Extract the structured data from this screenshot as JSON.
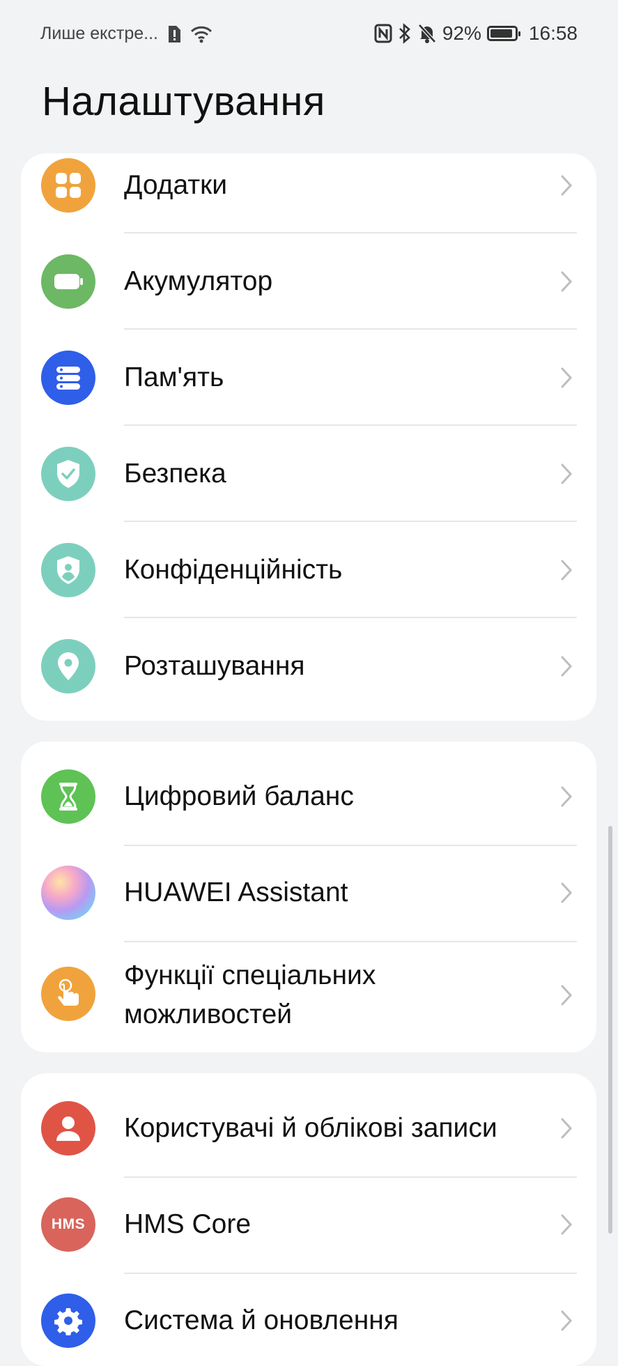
{
  "status_bar": {
    "carrier_text": "Лише екстре...",
    "battery_percent": "92%",
    "time": "16:58",
    "icons": [
      "sim-alert-icon",
      "wifi-icon",
      "nfc-icon",
      "bluetooth-icon",
      "muted-bell-icon",
      "battery-icon"
    ]
  },
  "page": {
    "title": "Налаштування"
  },
  "groups": [
    {
      "items": [
        {
          "label": "Додатки",
          "icon": "apps-icon",
          "color": "#f0a33c"
        },
        {
          "label": "Акумулятор",
          "icon": "battery-icon",
          "color": "#6cb865"
        },
        {
          "label": "Пам'ять",
          "icon": "storage-icon",
          "color": "#2f5ee8"
        },
        {
          "label": "Безпека",
          "icon": "shield-check-icon",
          "color": "#7dcfbd"
        },
        {
          "label": "Конфіденційність",
          "icon": "privacy-shield-icon",
          "color": "#7dcfbd"
        },
        {
          "label": "Розташування",
          "icon": "location-pin-icon",
          "color": "#7dcfbd"
        }
      ]
    },
    {
      "items": [
        {
          "label": "Цифровий баланс",
          "icon": "hourglass-icon",
          "color": "#5ec255"
        },
        {
          "label": "HUAWEI Assistant",
          "icon": "huawei-assistant-icon",
          "color": "#c9a6f2"
        },
        {
          "label_line1": "Функції спеціальних",
          "label_line2": "можливостей",
          "icon": "accessibility-hand-icon",
          "color": "#f0a33c"
        }
      ]
    },
    {
      "items": [
        {
          "label": "Користувачі й облікові записи",
          "icon": "user-icon",
          "color": "#e05446"
        },
        {
          "label": "HMS Core",
          "icon": "hms-icon",
          "icon_text": "HMS",
          "color": "#d9645c"
        },
        {
          "label": "Система й оновлення",
          "icon": "gear-icon",
          "color": "#2f5ee8"
        }
      ]
    }
  ]
}
